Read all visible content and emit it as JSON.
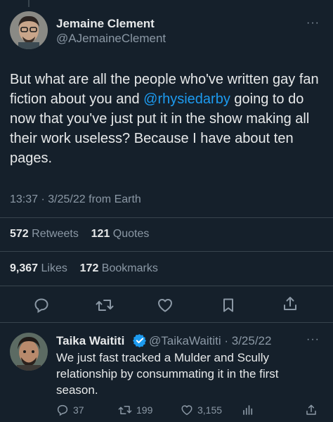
{
  "tweet": {
    "author_name": "Jemaine Clement",
    "author_handle": "@AJemaineClement",
    "text_before": "But what are all the people who've written gay fan fiction about you and ",
    "mention": "@rhysiedarby",
    "text_after": " going to do now that you've just put it in the show making all their work useless? Because I have about ten pages.",
    "time": "13:37",
    "date": "3/25/22",
    "source": "from Earth",
    "retweets_count": "572",
    "retweets_label": "Retweets",
    "quotes_count": "121",
    "quotes_label": "Quotes",
    "likes_count": "9,367",
    "likes_label": "Likes",
    "bookmarks_count": "172",
    "bookmarks_label": "Bookmarks",
    "more_label": "···"
  },
  "reply": {
    "author_name": "Taika Waititi",
    "author_handle": "@TaikaWaititi",
    "date": "3/25/22",
    "text": "We just fast tracked a Mulder and Scully relationship by consummating it in the first season.",
    "reply_count": "37",
    "retweet_count": "199",
    "like_count": "3,155",
    "more_label": "···"
  },
  "colors": {
    "background": "#15202b",
    "text": "#e7e9ea",
    "secondary": "#8b98a5",
    "accent": "#1d9bf0",
    "divider": "#38444d"
  }
}
